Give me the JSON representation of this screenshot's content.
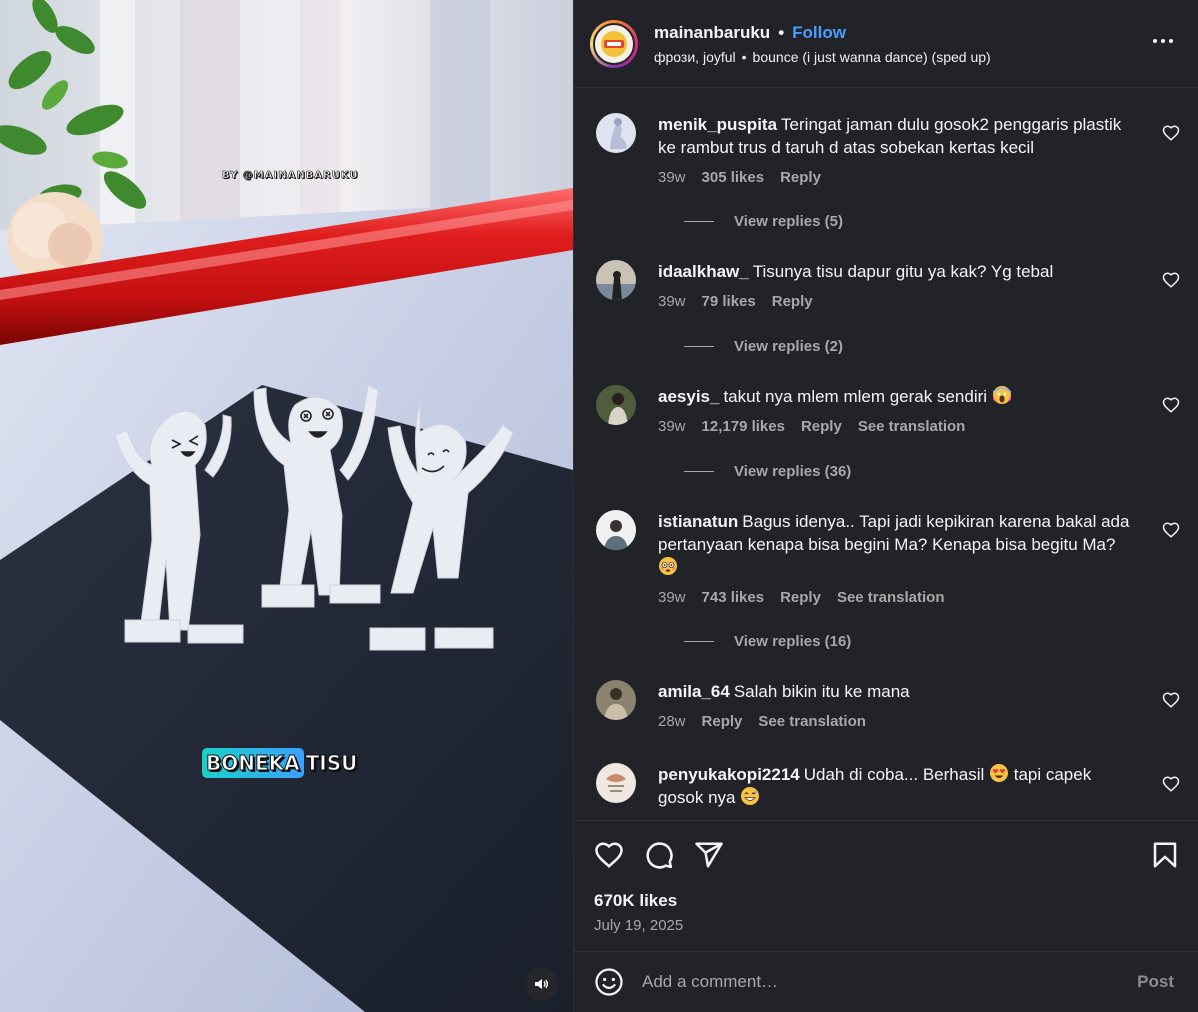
{
  "media": {
    "watermark": "BY @MAINANBARUKU",
    "caption_part1": "BONEKA",
    "caption_part2": "TISU"
  },
  "header": {
    "username": "mainanbaruku",
    "follow_label": "Follow",
    "dot": "•",
    "audio_artist": "фрози, joyful",
    "audio_sep": "•",
    "audio_track": "bounce (i just wanna dance) (sped up)"
  },
  "comments": [
    {
      "user": "menik_puspita",
      "text": "Teringat jaman dulu gosok2 penggaris plastik ke rambut trus d taruh d atas sobekan kertas kecil",
      "age": "39w",
      "likes": "305 likes",
      "reply": "Reply",
      "view_replies": "View replies (5)"
    },
    {
      "user": "idaalkhaw_",
      "text": "Tisunya tisu dapur gitu ya kak? Yg tebal",
      "age": "39w",
      "likes": "79 likes",
      "reply": "Reply",
      "view_replies": "View replies (2)"
    },
    {
      "user": "aesyis_",
      "text": "takut nya mlem mlem gerak sendiri",
      "emoji": "scream-emoji",
      "age": "39w",
      "likes": "12,179 likes",
      "reply": "Reply",
      "translate": "See translation",
      "view_replies": "View replies (36)"
    },
    {
      "user": "istianatun",
      "text": "Bagus idenya.. Tapi jadi kepikiran karena bakal ada pertanyaan kenapa bisa begini Ma? Kenapa bisa begitu Ma?",
      "emoji": "flushed-emoji",
      "age": "39w",
      "likes": "743 likes",
      "reply": "Reply",
      "translate": "See translation",
      "view_replies": "View replies (16)"
    },
    {
      "user": "amila_64",
      "text": "Salah bikin itu ke mana",
      "age": "28w",
      "reply": "Reply",
      "translate": "See translation"
    },
    {
      "user": "penyukakopi2214",
      "text_a": "Udah di coba... Berhasil",
      "text_b": "tapi capek gosok nya",
      "emoji_a": "heart-eyes-emoji",
      "emoji_b": "grin-sweat-emoji"
    }
  ],
  "footer": {
    "likes": "670K likes",
    "date": "July 19, 2025",
    "comment_placeholder": "Add a comment…",
    "post_label": "Post"
  },
  "colors": {
    "panel_bg": "#212328",
    "follow": "#4a9eff",
    "muted_text": "#a8a8a8"
  }
}
